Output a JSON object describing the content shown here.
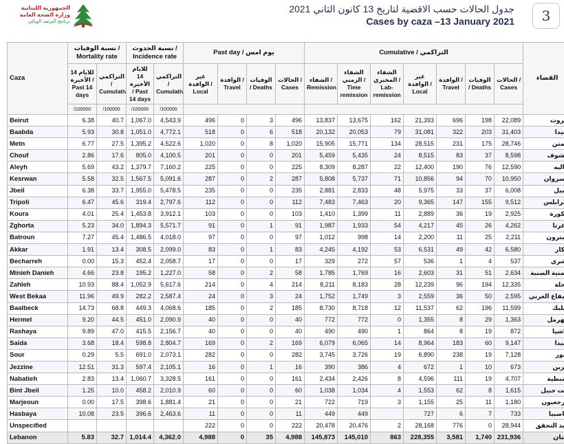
{
  "header": {
    "logo_ar_line1": "الجمهورية اللبنانية",
    "logo_ar_line2": "وزارة الصحة العامة",
    "logo_ar_line3": "برنامج الترصد الوبائي",
    "title_ar": "جدول الحالات حسب الاقضية لتاريخ 13 كانون الثاني 2021",
    "title_en": "Cases by caza –13 January 2021",
    "page_number": "3"
  },
  "table": {
    "groups": {
      "mortality": "نسبة الوفيات / Mortality rate",
      "incidence": "نسبة الحدوث / Incidence rate",
      "pastday": "Past day / يوم امس",
      "cumulative": "Cumulative / التراكمي"
    },
    "col_caza": "Caza",
    "col_caza_ar": "القضاء",
    "sub": {
      "m14": "للايام 14 الأخيرة / Past 14 days",
      "mcum": "التراكمي / Cumulative",
      "i14": "للايام 14 الأخيرة / Past 14 days",
      "icum": "التراكمي / Cumulative",
      "pd_local": "غير الوافدة / Local",
      "pd_travel": "الوافدة / Travel",
      "pd_deaths": "الوفيات / Deaths",
      "pd_cases": "الحالات / Cases",
      "c_remission": "الشفاء / Remission",
      "c_time": "الشفاء الزمني / Time remission",
      "c_lab": "الشفاء المخبري / Lab-remission",
      "c_local": "غير الوافدة / Local",
      "c_travel": "الوافدة / Travel",
      "c_deaths": "الوفيات / Deaths",
      "c_cases": "الحالات / Cases"
    },
    "per": "/100000",
    "rows": [
      [
        "Beirut",
        "6.38",
        "40.7",
        "1,067.0",
        "4,543.9",
        "496",
        "0",
        "3",
        "496",
        "13,837",
        "13,675",
        "162",
        "21,393",
        "696",
        "198",
        "22,089",
        "بيروت"
      ],
      [
        "Baabda",
        "5.93",
        "30.8",
        "1,051.0",
        "4,772.1",
        "518",
        "0",
        "6",
        "518",
        "20,132",
        "20,053",
        "79",
        "31,081",
        "322",
        "203",
        "31,403",
        "بعبدا"
      ],
      [
        "Metn",
        "6.77",
        "27.5",
        "1,395.2",
        "4,522.6",
        "1,020",
        "0",
        "8",
        "1,020",
        "15,905",
        "15,771",
        "134",
        "28,515",
        "231",
        "175",
        "28,746",
        "المتن"
      ],
      [
        "Chouf",
        "2.86",
        "17.6",
        "805.0",
        "4,100.5",
        "201",
        "0",
        "0",
        "201",
        "5,459",
        "5,435",
        "24",
        "8,515",
        "83",
        "37",
        "8,598",
        "الشوف"
      ],
      [
        "Aleyh",
        "5.69",
        "43.2",
        "1,379.7",
        "7,160.2",
        "225",
        "0",
        "0",
        "225",
        "8,309",
        "8,287",
        "22",
        "12,400",
        "190",
        "76",
        "12,590",
        "عاليه"
      ],
      [
        "Kesrwan",
        "5.58",
        "32.5",
        "1,567.5",
        "5,091.6",
        "287",
        "0",
        "2",
        "287",
        "5,808",
        "5,737",
        "71",
        "10,856",
        "94",
        "70",
        "10,950",
        "كسروان"
      ],
      [
        "Jbeil",
        "6.38",
        "33.7",
        "1,955.0",
        "5,478.5",
        "235",
        "0",
        "0",
        "235",
        "2,881",
        "2,833",
        "48",
        "5,975",
        "33",
        "37",
        "6,008",
        "جبيل"
      ],
      [
        "Tripoli",
        "6.47",
        "45.6",
        "319.4",
        "2,797.6",
        "112",
        "0",
        "0",
        "112",
        "7,483",
        "7,463",
        "20",
        "9,365",
        "147",
        "155",
        "9,512",
        "طرابلس"
      ],
      [
        "Koura",
        "4.01",
        "25.4",
        "1,453.8",
        "3,912.1",
        "103",
        "0",
        "0",
        "103",
        "1,410",
        "1,399",
        "11",
        "2,889",
        "36",
        "19",
        "2,925",
        "الكورة"
      ],
      [
        "Zghorta",
        "5.23",
        "34.0",
        "1,894.3",
        "5,571.7",
        "91",
        "0",
        "1",
        "91",
        "1,987",
        "1,933",
        "54",
        "4,217",
        "45",
        "26",
        "4,262",
        "زغرتا"
      ],
      [
        "Batroun",
        "7.27",
        "45.4",
        "1,486.5",
        "4,018.0",
        "97",
        "0",
        "0",
        "97",
        "1,012",
        "998",
        "14",
        "2,200",
        "11",
        "25",
        "2,211",
        "البترون"
      ],
      [
        "Akkar",
        "1.91",
        "13.4",
        "308.5",
        "2,099.0",
        "83",
        "0",
        "1",
        "83",
        "4,245",
        "4,192",
        "53",
        "6,531",
        "49",
        "42",
        "6,580",
        "عكار"
      ],
      [
        "Becharreh",
        "0.00",
        "15.3",
        "452.4",
        "2,058.7",
        "17",
        "0",
        "0",
        "17",
        "329",
        "272",
        "57",
        "536",
        "1",
        "4",
        "537",
        "بشري"
      ],
      [
        "Minieh Danieh",
        "4.66",
        "23.8",
        "195.2",
        "1,227.0",
        "58",
        "0",
        "2",
        "58",
        "1,785",
        "1,769",
        "16",
        "2,603",
        "31",
        "51",
        "2,634",
        "المنية الضنية"
      ],
      [
        "Zahleh",
        "10.93",
        "88.4",
        "1,052.9",
        "5,617.6",
        "214",
        "0",
        "4",
        "214",
        "8,211",
        "8,183",
        "28",
        "12,239",
        "96",
        "194",
        "12,335",
        "زحلة"
      ],
      [
        "West Bekaa",
        "11.96",
        "49.9",
        "282.2",
        "2,587.4",
        "24",
        "0",
        "3",
        "24",
        "1,752",
        "1,749",
        "3",
        "2,559",
        "36",
        "50",
        "2,595",
        "البقاع الغربي"
      ],
      [
        "Baalbeck",
        "14.73",
        "68.8",
        "449.3",
        "4,068.6",
        "185",
        "0",
        "2",
        "185",
        "8,730",
        "8,718",
        "12",
        "11,537",
        "62",
        "196",
        "11,599",
        "بعلبك"
      ],
      [
        "Hermel",
        "9.20",
        "44.5",
        "451.0",
        "2,090.9",
        "40",
        "0",
        "0",
        "40",
        "772",
        "772",
        "0",
        "1,355",
        "8",
        "29",
        "1,363",
        "الهرمل"
      ],
      [
        "Rashaya",
        "9.89",
        "47.0",
        "415.5",
        "2,156.7",
        "40",
        "0",
        "0",
        "40",
        "490",
        "490",
        "1",
        "864",
        "8",
        "19",
        "872",
        "راشيا"
      ],
      [
        "Saida",
        "3.68",
        "18.4",
        "598.8",
        "2,804.7",
        "169",
        "0",
        "2",
        "169",
        "6,079",
        "6,065",
        "14",
        "8,964",
        "183",
        "60",
        "9,147",
        "صيدا"
      ],
      [
        "Sour",
        "0.29",
        "5.5",
        "691.0",
        "2,073.1",
        "282",
        "0",
        "0",
        "282",
        "3,745",
        "3,726",
        "19",
        "6,890",
        "238",
        "19",
        "7,128",
        "صور"
      ],
      [
        "Jezzine",
        "12.51",
        "31.3",
        "597.4",
        "2,105.1",
        "16",
        "0",
        "1",
        "16",
        "390",
        "386",
        "4",
        "672",
        "1",
        "10",
        "673",
        "جزين"
      ],
      [
        "Nabatieh",
        "2.83",
        "13.4",
        "1,060.7",
        "3,328.5",
        "161",
        "0",
        "0",
        "161",
        "2,434",
        "2,426",
        "8",
        "4,596",
        "111",
        "19",
        "4,707",
        "النبطية"
      ],
      [
        "Bint Jbeil",
        "1.25",
        "10.0",
        "458.2",
        "2,010.9",
        "60",
        "0",
        "0",
        "60",
        "1,038",
        "1,034",
        "4",
        "1,553",
        "62",
        "8",
        "1,615",
        "بنت جبيل"
      ],
      [
        "Marjeoun",
        "0.00",
        "17.5",
        "398.6",
        "1,881.4",
        "21",
        "0",
        "0",
        "21",
        "722",
        "719",
        "3",
        "1,155",
        "25",
        "11",
        "1,180",
        "مرجعيون"
      ],
      [
        "Hasbaya",
        "10.08",
        "23.5",
        "396.6",
        "2,463.6",
        "11",
        "0",
        "0",
        "11",
        "449",
        "449",
        "",
        "727",
        "6",
        "7",
        "733",
        "حاصبيا"
      ],
      [
        "Unspecified",
        "",
        "",
        "",
        "",
        "222",
        "0",
        "0",
        "222",
        "20,478",
        "20,476",
        "2",
        "28,168",
        "776",
        "0",
        "28,944",
        "قيد التحقق"
      ]
    ],
    "total": [
      "Lebanon",
      "5.83",
      "32.7",
      "1,014.4",
      "4,362.0",
      "4,988",
      "0",
      "35",
      "4,988",
      "145,873",
      "145,010",
      "863",
      "228,355",
      "3,581",
      "1,740",
      "231,936",
      "لبنان"
    ]
  }
}
